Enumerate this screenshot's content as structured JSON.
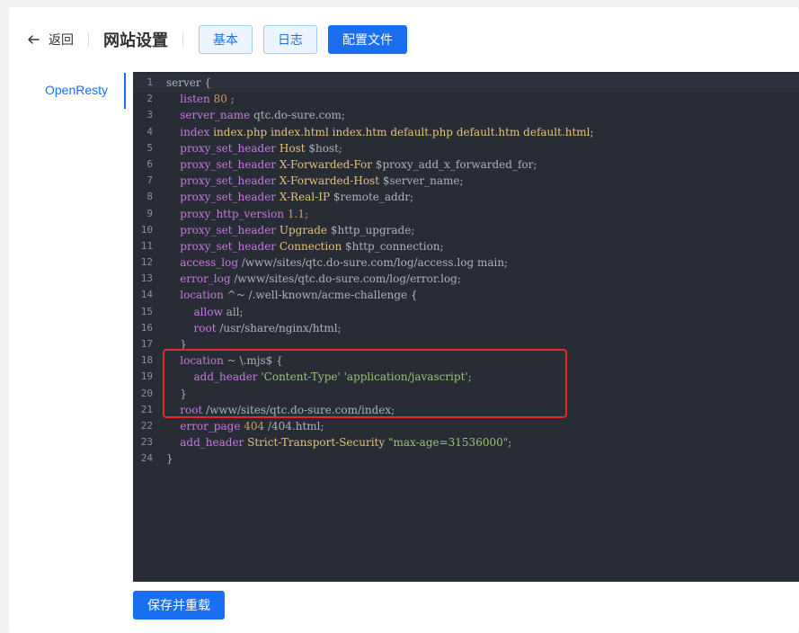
{
  "header": {
    "back_label": "返回",
    "title": "网站设置",
    "tabs": [
      {
        "label": "基本",
        "style": "plain"
      },
      {
        "label": "日志",
        "style": "plain"
      },
      {
        "label": "配置文件",
        "style": "primary"
      }
    ]
  },
  "side_tabs": [
    {
      "label": "OpenResty",
      "active": true
    }
  ],
  "editor": {
    "line_numbers": [
      "1",
      "2",
      "3",
      "4",
      "5",
      "6",
      "7",
      "8",
      "9",
      "10",
      "11",
      "12",
      "13",
      "14",
      "15",
      "16",
      "17",
      "18",
      "19",
      "20",
      "21",
      "22",
      "23",
      "24"
    ],
    "lines": [
      "server {",
      "    listen 80 ;",
      "    server_name qtc.do-sure.com;",
      "    index index.php index.html index.htm default.php default.htm default.html;",
      "    proxy_set_header Host $host;",
      "    proxy_set_header X-Forwarded-For $proxy_add_x_forwarded_for;",
      "    proxy_set_header X-Forwarded-Host $server_name;",
      "    proxy_set_header X-Real-IP $remote_addr;",
      "    proxy_http_version 1.1;",
      "    proxy_set_header Upgrade $http_upgrade;",
      "    proxy_set_header Connection $http_connection;",
      "    access_log /www/sites/qtc.do-sure.com/log/access.log main;",
      "    error_log /www/sites/qtc.do-sure.com/log/error.log;",
      "    location ^~ /.well-known/acme-challenge {",
      "        allow all;",
      "        root /usr/share/nginx/html;",
      "    }",
      "    location ~ \\.mjs$ {",
      "        add_header 'Content-Type' 'application/javascript';",
      "    }",
      "    root /www/sites/qtc.do-sure.com/index;",
      "    error_page 404 /404.html;",
      "    add_header Strict-Transport-Security \"max-age=31536000\";",
      "}"
    ]
  },
  "footer": {
    "save_label": "保存并重载"
  },
  "colors": {
    "accent": "#1a6ff0",
    "editor_bg": "#282c34",
    "highlight_border": "#e8262d"
  }
}
